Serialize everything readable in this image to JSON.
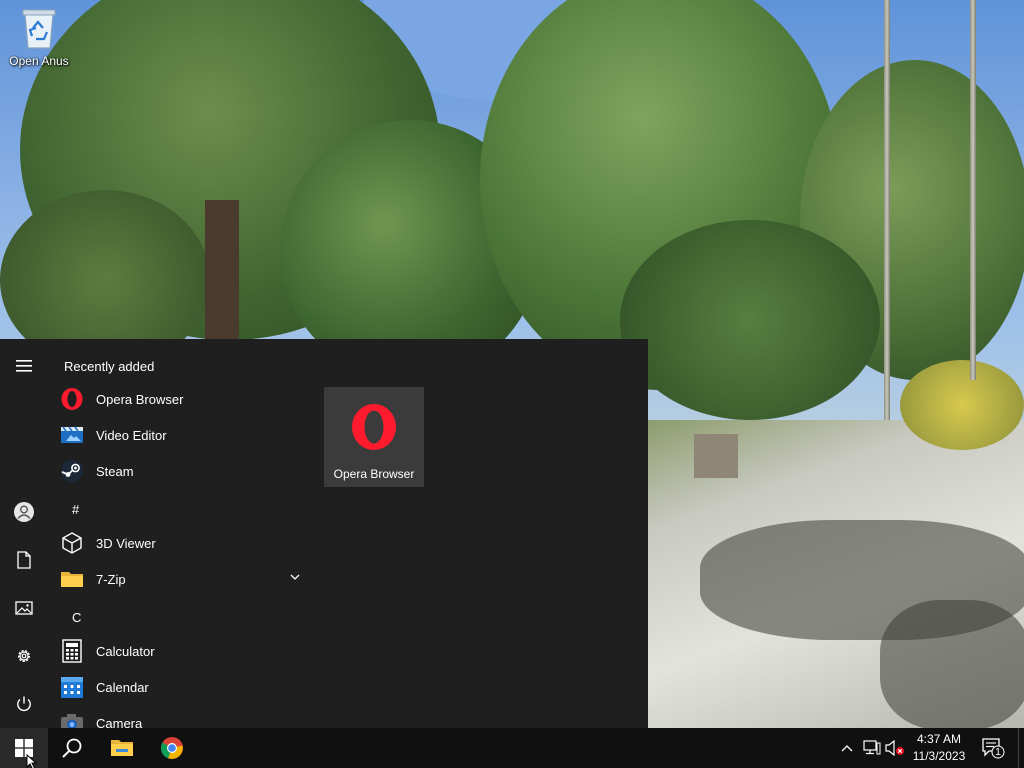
{
  "desktop": {
    "icons": [
      {
        "label": "Open Anus",
        "icon": "recycle-bin-icon"
      }
    ]
  },
  "start_menu": {
    "rail": [
      {
        "name": "expand",
        "icon": "hamburger-icon"
      },
      {
        "name": "user",
        "icon": "user-icon"
      },
      {
        "name": "documents",
        "icon": "document-icon"
      },
      {
        "name": "pictures",
        "icon": "pictures-icon"
      },
      {
        "name": "settings",
        "icon": "gear-icon"
      },
      {
        "name": "power",
        "icon": "power-icon"
      }
    ],
    "recently_added_heading": "Recently added",
    "recent": [
      {
        "label": "Opera Browser",
        "icon": "opera-icon"
      },
      {
        "label": "Video Editor",
        "icon": "video-editor-icon"
      },
      {
        "label": "Steam",
        "icon": "steam-icon"
      }
    ],
    "groups": [
      {
        "letter": "#",
        "items": [
          {
            "label": "3D Viewer",
            "icon": "cube-icon"
          },
          {
            "label": "7-Zip",
            "icon": "folder-icon",
            "expandable": true
          }
        ]
      },
      {
        "letter": "C",
        "items": [
          {
            "label": "Calculator",
            "icon": "calculator-icon"
          },
          {
            "label": "Calendar",
            "icon": "calendar-icon"
          },
          {
            "label": "Camera",
            "icon": "camera-icon"
          }
        ]
      }
    ],
    "tiles": [
      {
        "label": "Opera Browser",
        "icon": "opera-icon",
        "color": "#ff1b2d"
      }
    ]
  },
  "taskbar": {
    "start_icon": "windows-logo-icon",
    "search_icon": "search-icon",
    "pinned": [
      {
        "name": "File Explorer",
        "icon": "folder-icon"
      },
      {
        "name": "Google Chrome",
        "icon": "chrome-icon"
      }
    ],
    "tray": {
      "icons": [
        "chevron-up-icon",
        "network-icon",
        "volume-muted-icon"
      ],
      "time": "4:37 AM",
      "date": "11/3/2023",
      "notification_count": "1"
    }
  },
  "colors": {
    "accent_blue": "#0078d7",
    "start_menu_bg": "#1f1f1f",
    "tile_bg": "#3b3b3b",
    "taskbar_bg": "#101010",
    "opera_red": "#ff1b2d"
  }
}
